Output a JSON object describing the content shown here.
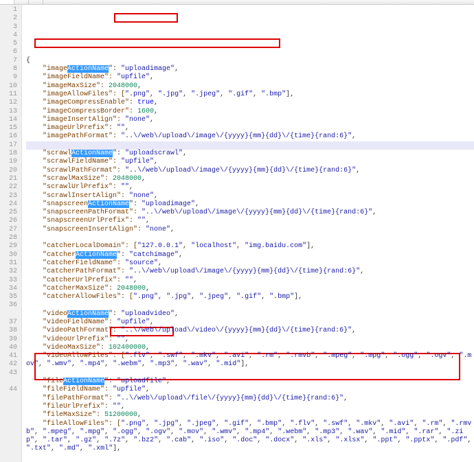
{
  "tabs": [
    {
      "label": ""
    },
    {
      "label": ""
    },
    {
      "label": ""
    }
  ],
  "code": {
    "lines": [
      [
        {
          "t": "{",
          "c": "pun"
        }
      ],
      [
        {
          "t": "    \"image",
          "c": "key"
        },
        {
          "t": "ActionName",
          "c": "key sel"
        },
        {
          "t": "\": ",
          "c": "pun"
        },
        {
          "t": "\"uploadimage\"",
          "c": "str"
        },
        {
          "t": ",",
          "c": "pun"
        }
      ],
      [
        {
          "t": "    \"imageFieldName\": ",
          "c": "key"
        },
        {
          "t": "\"upfile\"",
          "c": "str"
        },
        {
          "t": ",",
          "c": "pun"
        }
      ],
      [
        {
          "t": "    \"imageMaxSize\": ",
          "c": "key"
        },
        {
          "t": "2048000",
          "c": "num"
        },
        {
          "t": ",",
          "c": "pun"
        }
      ],
      [
        {
          "t": "    \"imageAllowFiles\": [",
          "c": "key"
        },
        {
          "t": "\".png\"",
          "c": "str"
        },
        {
          "t": ", ",
          "c": "pun"
        },
        {
          "t": "\".jpg\"",
          "c": "str"
        },
        {
          "t": ", ",
          "c": "pun"
        },
        {
          "t": "\".jpeg\"",
          "c": "str"
        },
        {
          "t": ", ",
          "c": "pun"
        },
        {
          "t": "\".gif\"",
          "c": "str"
        },
        {
          "t": ", ",
          "c": "pun"
        },
        {
          "t": "\".bmp\"",
          "c": "str"
        },
        {
          "t": "],",
          "c": "pun"
        }
      ],
      [
        {
          "t": "    \"imageCompressEnable\": ",
          "c": "key"
        },
        {
          "t": "true",
          "c": "kw"
        },
        {
          "t": ",",
          "c": "pun"
        }
      ],
      [
        {
          "t": "    \"imageCompressBorder\": ",
          "c": "key"
        },
        {
          "t": "1600",
          "c": "num"
        },
        {
          "t": ",",
          "c": "pun"
        }
      ],
      [
        {
          "t": "    \"imageInsertAlign\": ",
          "c": "key"
        },
        {
          "t": "\"none\"",
          "c": "str"
        },
        {
          "t": ",",
          "c": "pun"
        }
      ],
      [
        {
          "t": "    \"imageUrlPrefix\": ",
          "c": "key"
        },
        {
          "t": "\"\"",
          "c": "str"
        },
        {
          "t": ",",
          "c": "pun"
        }
      ],
      [
        {
          "t": "    \"imagePathFormat\": ",
          "c": "key"
        },
        {
          "t": "\"..\\/web\\/upload\\/image\\/{yyyy}{mm}{dd}\\/{time}{rand:6}\"",
          "c": "str"
        },
        {
          "t": ",",
          "c": "pun"
        }
      ],
      [
        {
          "t": " ",
          "c": "pun"
        }
      ],
      [
        {
          "t": "    \"scrawl",
          "c": "key"
        },
        {
          "t": "ActionName",
          "c": "key sel"
        },
        {
          "t": "\": ",
          "c": "pun"
        },
        {
          "t": "\"uploadscrawl\"",
          "c": "str"
        },
        {
          "t": ",",
          "c": "pun"
        }
      ],
      [
        {
          "t": "    \"scrawlFieldName\": ",
          "c": "key"
        },
        {
          "t": "\"upfile\"",
          "c": "str"
        },
        {
          "t": ",",
          "c": "pun"
        }
      ],
      [
        {
          "t": "    \"scrawlPathFormat\": ",
          "c": "key"
        },
        {
          "t": "\"..\\/web\\/upload\\/image\\/{yyyy}{mm}{dd}\\/{time}{rand:6}\"",
          "c": "str"
        },
        {
          "t": ",",
          "c": "pun"
        }
      ],
      [
        {
          "t": "    \"scrawlMaxSize\": ",
          "c": "key"
        },
        {
          "t": "2048000",
          "c": "num"
        },
        {
          "t": ",",
          "c": "pun"
        }
      ],
      [
        {
          "t": "    \"scrawlUrlPrefix\": ",
          "c": "key"
        },
        {
          "t": "\"\"",
          "c": "str"
        },
        {
          "t": ",",
          "c": "pun"
        }
      ],
      [
        {
          "t": "    \"scrawlInsertAlign\": ",
          "c": "key"
        },
        {
          "t": "\"none\"",
          "c": "str"
        },
        {
          "t": ",",
          "c": "pun"
        }
      ],
      [
        {
          "t": "    \"snapscreen",
          "c": "key"
        },
        {
          "t": "ActionName",
          "c": "key sel"
        },
        {
          "t": "\": ",
          "c": "pun"
        },
        {
          "t": "\"uploadimage\"",
          "c": "str"
        },
        {
          "t": ",",
          "c": "pun"
        }
      ],
      [
        {
          "t": "    \"snapscreenPathFormat\": ",
          "c": "key"
        },
        {
          "t": "\"..\\/web\\/upload\\/image\\/{yyyy}{mm}{dd}\\/{time}{rand:6}\"",
          "c": "str"
        },
        {
          "t": ",",
          "c": "pun"
        }
      ],
      [
        {
          "t": "    \"snapscreenUrlPrefix\": ",
          "c": "key"
        },
        {
          "t": "\"\"",
          "c": "str"
        },
        {
          "t": ",",
          "c": "pun"
        }
      ],
      [
        {
          "t": "    \"snapscreenInsertAlign\": ",
          "c": "key"
        },
        {
          "t": "\"none\"",
          "c": "str"
        },
        {
          "t": ",",
          "c": "pun"
        }
      ],
      [
        {
          "t": " ",
          "c": "pun"
        }
      ],
      [
        {
          "t": "    \"catcherLocalDomain\": [",
          "c": "key"
        },
        {
          "t": "\"127.0.0.1\"",
          "c": "str"
        },
        {
          "t": ", ",
          "c": "pun"
        },
        {
          "t": "\"localhost\"",
          "c": "str"
        },
        {
          "t": ", ",
          "c": "pun"
        },
        {
          "t": "\"img.baidu.com\"",
          "c": "str"
        },
        {
          "t": "],",
          "c": "pun"
        }
      ],
      [
        {
          "t": "    \"catcher",
          "c": "key"
        },
        {
          "t": "ActionName",
          "c": "key sel"
        },
        {
          "t": "\": ",
          "c": "pun"
        },
        {
          "t": "\"catchimage\"",
          "c": "str"
        },
        {
          "t": ",",
          "c": "pun"
        }
      ],
      [
        {
          "t": "    \"catcherFieldName\": ",
          "c": "key"
        },
        {
          "t": "\"source\"",
          "c": "str"
        },
        {
          "t": ",",
          "c": "pun"
        }
      ],
      [
        {
          "t": "    \"catcherPathFormat\": ",
          "c": "key"
        },
        {
          "t": "\"..\\/web\\/upload\\/image\\/{yyyy}{mm}{dd}\\/{time}{rand:6}\"",
          "c": "str"
        },
        {
          "t": ",",
          "c": "pun"
        }
      ],
      [
        {
          "t": "    \"catcherUrlPrefix\": ",
          "c": "key"
        },
        {
          "t": "\"\"",
          "c": "str"
        },
        {
          "t": ",",
          "c": "pun"
        }
      ],
      [
        {
          "t": "    \"catcherMaxSize\": ",
          "c": "key"
        },
        {
          "t": "2048000",
          "c": "num"
        },
        {
          "t": ",",
          "c": "pun"
        }
      ],
      [
        {
          "t": "    \"catcherAllowFiles\": [",
          "c": "key"
        },
        {
          "t": "\".png\"",
          "c": "str"
        },
        {
          "t": ", ",
          "c": "pun"
        },
        {
          "t": "\".jpg\"",
          "c": "str"
        },
        {
          "t": ", ",
          "c": "pun"
        },
        {
          "t": "\".jpeg\"",
          "c": "str"
        },
        {
          "t": ", ",
          "c": "pun"
        },
        {
          "t": "\".gif\"",
          "c": "str"
        },
        {
          "t": ", ",
          "c": "pun"
        },
        {
          "t": "\".bmp\"",
          "c": "str"
        },
        {
          "t": "],",
          "c": "pun"
        }
      ],
      [
        {
          "t": " ",
          "c": "pun"
        }
      ],
      [
        {
          "t": "    \"video",
          "c": "key"
        },
        {
          "t": "ActionName",
          "c": "key sel"
        },
        {
          "t": "\": ",
          "c": "pun"
        },
        {
          "t": "\"uploadvideo\"",
          "c": "str"
        },
        {
          "t": ",",
          "c": "pun"
        }
      ],
      [
        {
          "t": "    \"videoFieldName\": ",
          "c": "key"
        },
        {
          "t": "\"upfile\"",
          "c": "str"
        },
        {
          "t": ",",
          "c": "pun"
        }
      ],
      [
        {
          "t": "    \"videoPathFormat\": ",
          "c": "key"
        },
        {
          "t": "\"..\\/web\\/upload\\/video\\/{yyyy}{mm}{dd}\\/{time}{rand:6}\"",
          "c": "str"
        },
        {
          "t": ",",
          "c": "pun"
        }
      ],
      [
        {
          "t": "    \"videoUrlPrefix\": ",
          "c": "key"
        },
        {
          "t": "\"\"",
          "c": "str"
        },
        {
          "t": ",",
          "c": "pun"
        }
      ],
      [
        {
          "t": "    \"videoMaxSize\": ",
          "c": "key"
        },
        {
          "t": "102400000",
          "c": "num"
        },
        {
          "t": ",",
          "c": "pun"
        }
      ],
      [
        {
          "t": "    \"videoAllowFiles\": [",
          "c": "key"
        },
        {
          "t": "\".flv\"",
          "c": "str"
        },
        {
          "t": ", ",
          "c": "pun"
        },
        {
          "t": "\".swf\"",
          "c": "str"
        },
        {
          "t": ", ",
          "c": "pun"
        },
        {
          "t": "\".mkv\"",
          "c": "str"
        },
        {
          "t": ", ",
          "c": "pun"
        },
        {
          "t": "\".avi\"",
          "c": "str"
        },
        {
          "t": ", ",
          "c": "pun"
        },
        {
          "t": "\".rm\"",
          "c": "str"
        },
        {
          "t": ", ",
          "c": "pun"
        },
        {
          "t": "\".rmvb\"",
          "c": "str"
        },
        {
          "t": ", ",
          "c": "pun"
        },
        {
          "t": "\".mpeg\"",
          "c": "str"
        },
        {
          "t": ", ",
          "c": "pun"
        },
        {
          "t": "\".mpg\"",
          "c": "str"
        },
        {
          "t": ", ",
          "c": "pun"
        },
        {
          "t": "\".ogg\"",
          "c": "str"
        },
        {
          "t": ", ",
          "c": "pun"
        },
        {
          "t": "\".ogv\"",
          "c": "str"
        },
        {
          "t": ", ",
          "c": "pun"
        },
        {
          "t": "\".mov\"",
          "c": "str"
        },
        {
          "t": ", ",
          "c": "pun"
        },
        {
          "t": "\".wmv\"",
          "c": "str"
        },
        {
          "t": ", ",
          "c": "pun"
        },
        {
          "t": "\".mp4\"",
          "c": "str"
        },
        {
          "t": ", ",
          "c": "pun"
        },
        {
          "t": "\".webm\"",
          "c": "str"
        },
        {
          "t": ", ",
          "c": "pun"
        },
        {
          "t": "\".mp3\"",
          "c": "str"
        },
        {
          "t": ", ",
          "c": "pun"
        },
        {
          "t": "\".wav\"",
          "c": "str"
        },
        {
          "t": ", ",
          "c": "pun"
        },
        {
          "t": "\".mid\"",
          "c": "str"
        },
        {
          "t": "],",
          "c": "pun"
        }
      ],
      [
        {
          "t": " ",
          "c": "pun"
        }
      ],
      [
        {
          "t": "    \"file",
          "c": "key"
        },
        {
          "t": "ActionName",
          "c": "key sel"
        },
        {
          "t": "\": ",
          "c": "pun"
        },
        {
          "t": "\"uploadfile\"",
          "c": "str"
        },
        {
          "t": ",",
          "c": "pun"
        }
      ],
      [
        {
          "t": "    \"fileFieldName\": ",
          "c": "key"
        },
        {
          "t": "\"upfile\"",
          "c": "str"
        },
        {
          "t": ",",
          "c": "pun"
        }
      ],
      [
        {
          "t": "    \"filePathFormat\": ",
          "c": "key"
        },
        {
          "t": "\"..\\/web\\/upload\\/file\\/{yyyy}{mm}{dd}\\/{time}{rand:6}\"",
          "c": "str"
        },
        {
          "t": ",",
          "c": "pun"
        }
      ],
      [
        {
          "t": "    \"fileUrlPrefix\": ",
          "c": "key"
        },
        {
          "t": "\"\"",
          "c": "str"
        },
        {
          "t": ",",
          "c": "pun"
        }
      ],
      [
        {
          "t": "    \"fileMaxSize\": ",
          "c": "key"
        },
        {
          "t": "51200000",
          "c": "num"
        },
        {
          "t": ",",
          "c": "pun"
        }
      ],
      [
        {
          "t": "    \"fileAllowFiles\": [",
          "c": "key"
        },
        {
          "t": "\".png\"",
          "c": "str"
        },
        {
          "t": ", ",
          "c": "pun"
        },
        {
          "t": "\".jpg\"",
          "c": "str"
        },
        {
          "t": ", ",
          "c": "pun"
        },
        {
          "t": "\".jpeg\"",
          "c": "str"
        },
        {
          "t": ", ",
          "c": "pun"
        },
        {
          "t": "\".gif\"",
          "c": "str"
        },
        {
          "t": ", ",
          "c": "pun"
        },
        {
          "t": "\".bmp\"",
          "c": "str"
        },
        {
          "t": ", ",
          "c": "pun"
        },
        {
          "t": "\".flv\"",
          "c": "str"
        },
        {
          "t": ", ",
          "c": "pun"
        },
        {
          "t": "\".swf\"",
          "c": "str"
        },
        {
          "t": ", ",
          "c": "pun"
        },
        {
          "t": "\".mkv\"",
          "c": "str"
        },
        {
          "t": ", ",
          "c": "pun"
        },
        {
          "t": "\".avi\"",
          "c": "str"
        },
        {
          "t": ", ",
          "c": "pun"
        },
        {
          "t": "\".rm\"",
          "c": "str"
        },
        {
          "t": ", ",
          "c": "pun"
        },
        {
          "t": "\".rmvb\"",
          "c": "str"
        },
        {
          "t": ", ",
          "c": "pun"
        },
        {
          "t": "\".mpeg\"",
          "c": "str"
        },
        {
          "t": ", ",
          "c": "pun"
        },
        {
          "t": "\".mpg\"",
          "c": "str"
        },
        {
          "t": ", ",
          "c": "pun"
        },
        {
          "t": "\".ogg\"",
          "c": "str"
        },
        {
          "t": ", ",
          "c": "pun"
        },
        {
          "t": "\".ogv\"",
          "c": "str"
        },
        {
          "t": ", ",
          "c": "pun"
        },
        {
          "t": "\".mov\"",
          "c": "str"
        },
        {
          "t": ", ",
          "c": "pun"
        },
        {
          "t": "\".wmv\"",
          "c": "str"
        },
        {
          "t": ", ",
          "c": "pun"
        },
        {
          "t": "\".mp4\"",
          "c": "str"
        },
        {
          "t": ", ",
          "c": "pun"
        },
        {
          "t": "\".webm\"",
          "c": "str"
        },
        {
          "t": ", ",
          "c": "pun"
        },
        {
          "t": "\".mp3\"",
          "c": "str"
        },
        {
          "t": ", ",
          "c": "pun"
        },
        {
          "t": "\".wav\"",
          "c": "str"
        },
        {
          "t": ", ",
          "c": "pun"
        },
        {
          "t": "\".mid\"",
          "c": "str"
        },
        {
          "t": ", ",
          "c": "pun"
        },
        {
          "t": "\".rar\"",
          "c": "str"
        },
        {
          "t": ", ",
          "c": "pun"
        },
        {
          "t": "\".zip\"",
          "c": "str"
        },
        {
          "t": ", ",
          "c": "pun"
        },
        {
          "t": "\".tar\"",
          "c": "str"
        },
        {
          "t": ", ",
          "c": "pun"
        },
        {
          "t": "\".gz\"",
          "c": "str"
        },
        {
          "t": ", ",
          "c": "pun"
        },
        {
          "t": "\".7z\"",
          "c": "str"
        },
        {
          "t": ", ",
          "c": "pun"
        },
        {
          "t": "\".bz2\"",
          "c": "str"
        },
        {
          "t": ", ",
          "c": "pun"
        },
        {
          "t": "\".cab\"",
          "c": "str"
        },
        {
          "t": ", ",
          "c": "pun"
        },
        {
          "t": "\".iso\"",
          "c": "str"
        },
        {
          "t": ", ",
          "c": "pun"
        },
        {
          "t": "\".doc\"",
          "c": "str"
        },
        {
          "t": ", ",
          "c": "pun"
        },
        {
          "t": "\".docx\"",
          "c": "str"
        },
        {
          "t": ", ",
          "c": "pun"
        },
        {
          "t": "\".xls\"",
          "c": "str"
        },
        {
          "t": ", ",
          "c": "pun"
        },
        {
          "t": "\".xlsx\"",
          "c": "str"
        },
        {
          "t": ", ",
          "c": "pun"
        },
        {
          "t": "\".ppt\"",
          "c": "str"
        },
        {
          "t": ", ",
          "c": "pun"
        },
        {
          "t": "\".pptx\"",
          "c": "str"
        },
        {
          "t": ", ",
          "c": "pun"
        },
        {
          "t": "\".pdf\"",
          "c": "str"
        },
        {
          "t": ", ",
          "c": "pun"
        },
        {
          "t": "\".txt\"",
          "c": "str"
        },
        {
          "t": ", ",
          "c": "pun"
        },
        {
          "t": "\".md\"",
          "c": "str"
        },
        {
          "t": ", ",
          "c": "pun"
        },
        {
          "t": "\".xml\"",
          "c": "str"
        },
        {
          "t": "],",
          "c": "pun"
        }
      ],
      [
        {
          "t": " ",
          "c": "pun"
        }
      ]
    ],
    "highlight_line": 11,
    "wrap_lines": [
      36,
      43
    ]
  }
}
